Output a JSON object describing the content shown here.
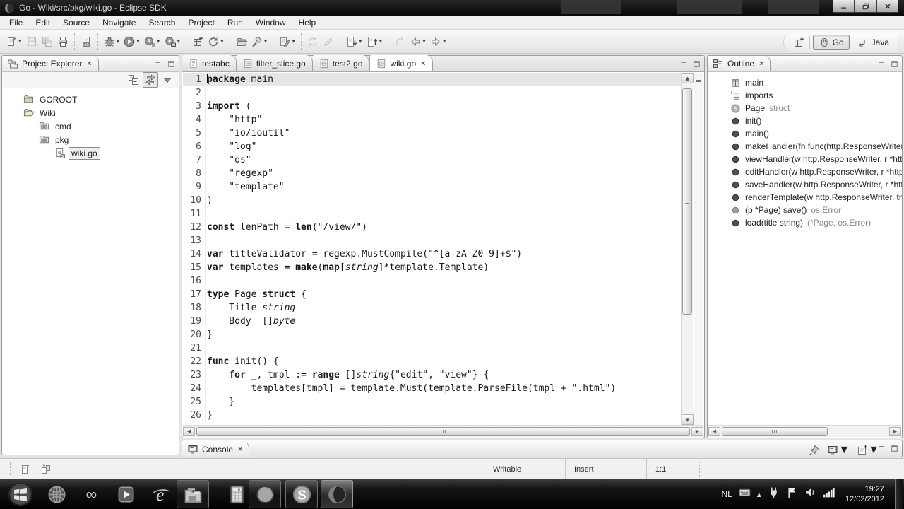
{
  "window": {
    "title": "Go - Wiki/src/pkg/wiki.go - Eclipse SDK",
    "controls": [
      "minimize",
      "restore",
      "close"
    ]
  },
  "menu_bar": {
    "items": [
      "File",
      "Edit",
      "Source",
      "Navigate",
      "Search",
      "Project",
      "Run",
      "Window",
      "Help"
    ]
  },
  "toolbar": {
    "groups": [
      [
        {
          "icon": "new",
          "dropdown": true
        },
        {
          "icon": "save",
          "disabled": true
        },
        {
          "icon": "save-all",
          "disabled": true
        },
        {
          "icon": "print"
        }
      ],
      [
        {
          "icon": "binary-file"
        }
      ],
      [
        {
          "icon": "debug",
          "dropdown": true
        },
        {
          "icon": "run",
          "dropdown": true
        },
        {
          "icon": "run-external",
          "dropdown": true
        },
        {
          "icon": "run-last",
          "dropdown": true
        }
      ],
      [
        {
          "icon": "new-project"
        },
        {
          "icon": "build",
          "dropdown": true
        }
      ],
      [
        {
          "icon": "open-resource"
        },
        {
          "icon": "search",
          "dropdown": true
        }
      ],
      [
        {
          "icon": "mark-occurrences",
          "dropdown": true
        }
      ],
      [
        {
          "icon": "synchronize",
          "disabled": true
        },
        {
          "icon": "format",
          "disabled": true
        }
      ],
      [
        {
          "icon": "next-annotation",
          "dropdown": true
        },
        {
          "icon": "previous-annotation",
          "dropdown": true
        }
      ],
      [
        {
          "icon": "last-edit",
          "disabled": true
        },
        {
          "icon": "back",
          "dropdown": true
        },
        {
          "icon": "forward",
          "dropdown": true
        }
      ]
    ]
  },
  "perspective_bar": {
    "perspectives": [
      {
        "label": "Go",
        "icon": "go-perspective",
        "active": true
      },
      {
        "label": "Java",
        "icon": "java-perspective",
        "active": false
      }
    ]
  },
  "project_explorer": {
    "title": "Project Explorer",
    "toolbar_icons": [
      {
        "icon": "collapse-all"
      },
      {
        "icon": "link-editor",
        "pressed": true
      },
      {
        "icon": "view-menu"
      }
    ],
    "controls": [
      "minimize",
      "maximize"
    ],
    "tree": [
      {
        "label": "GOROOT",
        "icon": "folder-closed",
        "indent": 1
      },
      {
        "label": "Wiki",
        "icon": "folder-open",
        "indent": 1
      },
      {
        "label": "cmd",
        "icon": "package-folder",
        "indent": 2
      },
      {
        "label": "pkg",
        "icon": "package-folder",
        "indent": 2
      },
      {
        "label": "wiki.go",
        "icon": "go-file",
        "indent": 3,
        "selected": true
      }
    ]
  },
  "editor": {
    "controls": [
      "minimize",
      "maximize"
    ],
    "tabs": [
      {
        "label": "testabc",
        "icon": "text-file",
        "active": false
      },
      {
        "label": "filter_slice.go",
        "icon": "go-file-tab",
        "active": false
      },
      {
        "label": "test2.go",
        "icon": "go-file-tab",
        "active": false
      },
      {
        "label": "wiki.go",
        "icon": "go-file-tab",
        "active": true
      }
    ],
    "code_lines": [
      {
        "n": 1,
        "current": true,
        "segs": [
          [
            "b",
            "package"
          ],
          [
            "p",
            " main"
          ]
        ]
      },
      {
        "n": 2,
        "segs": []
      },
      {
        "n": 3,
        "segs": [
          [
            "b",
            "import"
          ],
          [
            "p",
            " ("
          ]
        ]
      },
      {
        "n": 4,
        "segs": [
          [
            "p",
            "    \"http\""
          ]
        ]
      },
      {
        "n": 5,
        "segs": [
          [
            "p",
            "    \"io/ioutil\""
          ]
        ]
      },
      {
        "n": 6,
        "segs": [
          [
            "p",
            "    \"log\""
          ]
        ]
      },
      {
        "n": 7,
        "segs": [
          [
            "p",
            "    \"os\""
          ]
        ]
      },
      {
        "n": 8,
        "segs": [
          [
            "p",
            "    \"regexp\""
          ]
        ]
      },
      {
        "n": 9,
        "segs": [
          [
            "p",
            "    \"template\""
          ]
        ]
      },
      {
        "n": 10,
        "segs": [
          [
            "p",
            ")"
          ]
        ]
      },
      {
        "n": 11,
        "segs": []
      },
      {
        "n": 12,
        "segs": [
          [
            "b",
            "const"
          ],
          [
            "p",
            " lenPath = "
          ],
          [
            "b",
            "len"
          ],
          [
            "p",
            "(\"/view/\")"
          ]
        ]
      },
      {
        "n": 13,
        "segs": []
      },
      {
        "n": 14,
        "segs": [
          [
            "b",
            "var"
          ],
          [
            "p",
            " titleValidator = regexp.MustCompile(\"^[a-zA-Z0-9]+$\")"
          ]
        ]
      },
      {
        "n": 15,
        "segs": [
          [
            "b",
            "var"
          ],
          [
            "p",
            " templates = "
          ],
          [
            "b",
            "make"
          ],
          [
            "p",
            "("
          ],
          [
            "b",
            "map"
          ],
          [
            "p",
            "["
          ],
          [
            "i",
            "string"
          ],
          [
            "p",
            "]*template.Template)"
          ]
        ]
      },
      {
        "n": 16,
        "segs": []
      },
      {
        "n": 17,
        "segs": [
          [
            "b",
            "type"
          ],
          [
            "p",
            " Page "
          ],
          [
            "b",
            "struct"
          ],
          [
            "p",
            " {"
          ]
        ]
      },
      {
        "n": 18,
        "segs": [
          [
            "p",
            "    Title "
          ],
          [
            "i",
            "string"
          ]
        ]
      },
      {
        "n": 19,
        "segs": [
          [
            "p",
            "    Body  []"
          ],
          [
            "i",
            "byte"
          ]
        ]
      },
      {
        "n": 20,
        "segs": [
          [
            "p",
            "}"
          ]
        ]
      },
      {
        "n": 21,
        "segs": []
      },
      {
        "n": 22,
        "segs": [
          [
            "b",
            "func"
          ],
          [
            "p",
            " init() {"
          ]
        ]
      },
      {
        "n": 23,
        "segs": [
          [
            "p",
            "    "
          ],
          [
            "b",
            "for"
          ],
          [
            "p",
            " _, tmpl := "
          ],
          [
            "b",
            "range"
          ],
          [
            "p",
            " []"
          ],
          [
            "i",
            "string"
          ],
          [
            "p",
            "{\"edit\", \"view\"} {"
          ]
        ]
      },
      {
        "n": 24,
        "segs": [
          [
            "p",
            "        templates[tmpl] = template.Must(template.ParseFile(tmpl + \".html\")"
          ]
        ]
      },
      {
        "n": 25,
        "segs": [
          [
            "p",
            "    }"
          ]
        ]
      },
      {
        "n": 26,
        "segs": [
          [
            "p",
            "}"
          ]
        ]
      }
    ]
  },
  "outline": {
    "title": "Outline",
    "controls": [
      "minimize",
      "maximize"
    ],
    "items": [
      {
        "icon": "package",
        "label": "main"
      },
      {
        "icon": "imports",
        "label": "imports"
      },
      {
        "icon": "struct",
        "label": "Page",
        "suffix": " struct"
      },
      {
        "icon": "method",
        "label": "init()"
      },
      {
        "icon": "method",
        "label": "main()"
      },
      {
        "icon": "method",
        "label": "makeHandler(fn func(http.ResponseWriter,"
      },
      {
        "icon": "method",
        "label": "viewHandler(w http.ResponseWriter, r *http."
      },
      {
        "icon": "method",
        "label": "editHandler(w http.ResponseWriter, r *http.F"
      },
      {
        "icon": "method",
        "label": "saveHandler(w http.ResponseWriter, r *http."
      },
      {
        "icon": "method",
        "label": "renderTemplate(w http.ResponseWriter, tmp"
      },
      {
        "icon": "method-gray",
        "label": "(p *Page) save()",
        "suffix": " os.Error"
      },
      {
        "icon": "method",
        "label": "load(title string)",
        "suffix": " (*Page, os.Error)"
      }
    ]
  },
  "console": {
    "title": "Console",
    "toolbar_icons": [
      "pin-console",
      "display-selected-console",
      "open-console"
    ],
    "controls": [
      "minimize",
      "maximize"
    ]
  },
  "status_bar": {
    "left_icons": [
      "trim-fast-view",
      "trim-layout"
    ],
    "writable": "Writable",
    "insert_mode": "Insert",
    "caret_position": "1:1"
  },
  "taskbar": {
    "items": [
      {
        "icon": "start"
      },
      {
        "icon": "network-globe"
      },
      {
        "icon": "infinity-app"
      },
      {
        "icon": "media-player"
      },
      {
        "icon": "internet-explorer"
      },
      {
        "icon": "windows-explorer",
        "open": true
      },
      {
        "icon": "calculator"
      },
      {
        "icon": "firefox",
        "open": true
      },
      {
        "icon": "skype",
        "open": true
      },
      {
        "icon": "eclipse",
        "open": true,
        "active": true
      }
    ],
    "tray": {
      "language": "NL",
      "icons": [
        "keyboard",
        "show-hidden",
        "power",
        "action-center",
        "volume",
        "network"
      ],
      "time": "19:27",
      "date": "12/02/2012"
    }
  }
}
